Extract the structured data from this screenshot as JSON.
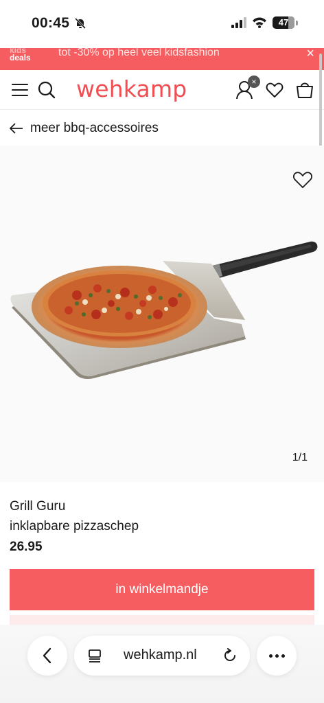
{
  "status_bar": {
    "time": "00:45",
    "battery": "47",
    "icons": [
      "bell-slash-icon",
      "signal-icon",
      "wifi-icon",
      "battery-icon"
    ]
  },
  "promo": {
    "logo_line1": "kids",
    "logo_line2": "deals",
    "text": "tot -30% op heel veel kidsfashion",
    "close": "×"
  },
  "header": {
    "logo": "wehkamp",
    "account_badge": "×",
    "icons": [
      "menu-icon",
      "search-icon",
      "account-icon",
      "heart-icon",
      "shopping-bag-icon"
    ]
  },
  "navigation": {
    "back_label": "meer bbq-accessoires"
  },
  "product": {
    "image_pager": "1/1",
    "brand": "Grill Guru",
    "name": "inklapbare pizzaschep",
    "price": "26.95",
    "add_to_cart": "in winkelmandje"
  },
  "browser": {
    "url": "wehkamp.nl",
    "icons": [
      "chevron-left-icon",
      "tabs-icon",
      "reload-icon",
      "more-icon"
    ]
  },
  "colors": {
    "brand": "#f04e53",
    "banner": "#f55d60",
    "button": "#f55d60"
  }
}
